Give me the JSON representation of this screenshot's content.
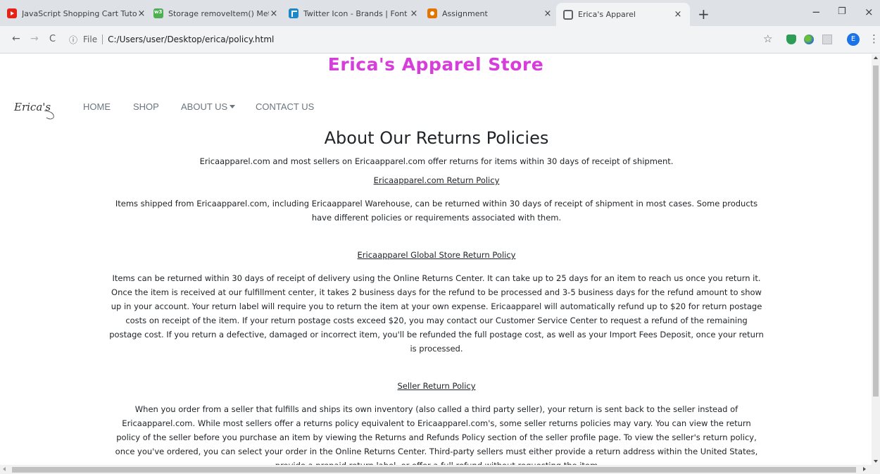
{
  "browser": {
    "tabs": [
      {
        "title": "JavaScript Shopping Cart Tutorial",
        "icon": "youtube-icon"
      },
      {
        "title": "Storage removeItem() Method",
        "icon": "w3schools-icon"
      },
      {
        "title": "Twitter Icon - Brands | Font Awesome",
        "icon": "font-awesome-icon"
      },
      {
        "title": "Assignment",
        "icon": "assignment-icon"
      },
      {
        "title": "Erica's Apparel",
        "icon": "globe-icon"
      }
    ],
    "close_glyph": "×",
    "new_tab_glyph": "+",
    "address": {
      "info_glyph": "ⓘ",
      "scheme_label": "File",
      "url": "C:/Users/user/Desktop/erica/policy.html"
    },
    "profile_initial": "E",
    "window_controls": {
      "minimize": "−",
      "restore": "❐",
      "close": "×"
    },
    "nav_glyphs": {
      "back": "←",
      "forward": "→",
      "reload": "C",
      "star": "☆",
      "menu": "⋮"
    }
  },
  "site": {
    "store_title": "Erica's Apparel Store",
    "logo_text": "Erica's",
    "nav": [
      {
        "label": "HOME"
      },
      {
        "label": "SHOP"
      },
      {
        "label": "ABOUT US"
      },
      {
        "label": "CONTACT US"
      }
    ]
  },
  "page": {
    "heading": "About Our Returns Policies",
    "intro": "Ericaapparel.com and most sellers on Ericaapparel.com offer returns for items within 30 days of receipt of shipment.",
    "sections": [
      {
        "title": "Ericaapparel.com Return Policy",
        "body": "Items shipped from Ericaapparel.com, including Ericaapparel Warehouse, can be returned within 30 days of receipt of shipment in most cases. Some products have different policies or requirements associated with them."
      },
      {
        "title": "Ericaapparel Global Store Return Policy",
        "body": "Items can be returned within 30 days of receipt of delivery using the Online Returns Center. It can take up to 25 days for an item to reach us once you return it. Once the item is received at our fulfillment center, it takes 2 business days for the refund to be processed and 3-5 business days for the refund amount to show up in your account. Your return label will require you to return the item at your own expense. Ericaapparel will automatically refund up to $20 for return postage costs on receipt of the item. If your return postage costs exceed $20, you may contact our Customer Service Center to request a refund of the remaining postage cost. If you return a defective, damaged or incorrect item, you'll be refunded the full postage cost, as well as your Import Fees Deposit, once your return is processed."
      },
      {
        "title": "Seller Return Policy",
        "body": "When you order from a seller that fulfills and ships its own inventory (also called a third party seller), your return is sent back to the seller instead of Ericaapparel.com. While most sellers offer a returns policy equivalent to Ericaapparel.com's, some seller returns policies may vary. You can view the return policy of the seller before you purchase an item by viewing the Returns and Refunds Policy section of the seller profile page. To view the seller's return policy, once you've ordered, you can select your order in the Online Returns Center. Third-party sellers must either provide a return address within the United States, provide a prepaid return label, or offer a full refund without requesting the item"
      }
    ]
  },
  "colors": {
    "store_title": "#d63ddb",
    "nav_link": "#6c757d",
    "tab_strip": "#dee1e6",
    "toolbar": "#f1f3f4"
  }
}
